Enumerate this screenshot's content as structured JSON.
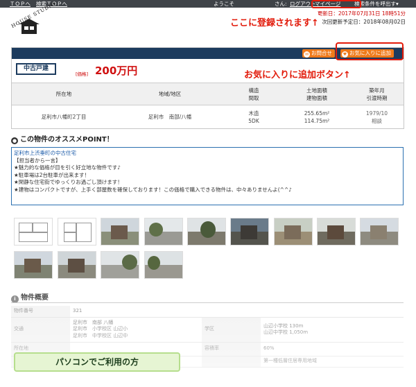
{
  "topbar": {
    "top_link": "ＴＯＰへ",
    "search_top_link": "検索ＴＯＰへ",
    "welcome": "ようこそ",
    "san": "さん:",
    "logout": "ログアウト",
    "mypage": "マイページ",
    "search_recall": "検索条件を呼出す▾"
  },
  "logo": {
    "text": "HOUSE STUDIO"
  },
  "dates": {
    "registered": "更新日：2017年07月31日 18時51分",
    "next_update": "次回更新予定日：2018年08月02日"
  },
  "annotations": {
    "registered_here": "ここに登録されます↑",
    "fav_button": "お気に入りに追加ボタン↑",
    "pc_users": "パソコンでご利用の方"
  },
  "panel": {
    "inquiry_btn": "お問合せ",
    "fav_btn": "お気に入りに追加",
    "type": "中古戸建",
    "price_label": "[価格]",
    "price": "200万円",
    "headers": [
      "所在地",
      "地域/地区",
      "構造\n間取",
      "土地面積\n建物面積",
      "築年月\n引渡時期"
    ],
    "row": {
      "location": "足利市八幡町2丁目",
      "area": "足利市　南部/八幡",
      "structure": "木造",
      "layout": "5DK",
      "land_area": "255.65m²",
      "building_area": "114.75m²",
      "built": "1979/10",
      "handover": "相談"
    }
  },
  "point": {
    "title": "この物件のオススメPOINT！",
    "lines": [
      "足利市上渋垂町の中古住宅",
      "【担当者から一言】",
      "★魅力的な価格が目を引く好立地な物件です♪",
      "★駐車場は2台駐車が出来ます！",
      "★閑静な住宅街でゆっくりお過ごし頂けます！",
      "★建物はコンパクトですが、上手く部屋数を確保しております！この価格で購入できる物件は、中々ありませんよ(^^♪"
    ]
  },
  "overview": {
    "title": "物件概要",
    "rows": [
      {
        "k": "物件番号",
        "v": "321"
      },
      {
        "k": "交通",
        "v1": "足利市　南部 八幡",
        "v2": "足利市　小学校区 山辺小",
        "v3": "足利市　中学校区 山辺中",
        "k2": "学区",
        "w1": "山辺小学校 130m",
        "w2": "山辺中学校 1,050m"
      },
      {
        "k": "所在地",
        "v": "",
        "k2": "容積率",
        "w1": "60%"
      },
      {
        "k": "",
        "v": "",
        "k2": "",
        "w1": "第一種低層住居専用地域"
      }
    ]
  },
  "colors": {
    "navy": "#1c3b5e",
    "orange": "#ef7a1a",
    "price_red": "#d01010",
    "annotation_red": "#e21a0a"
  }
}
